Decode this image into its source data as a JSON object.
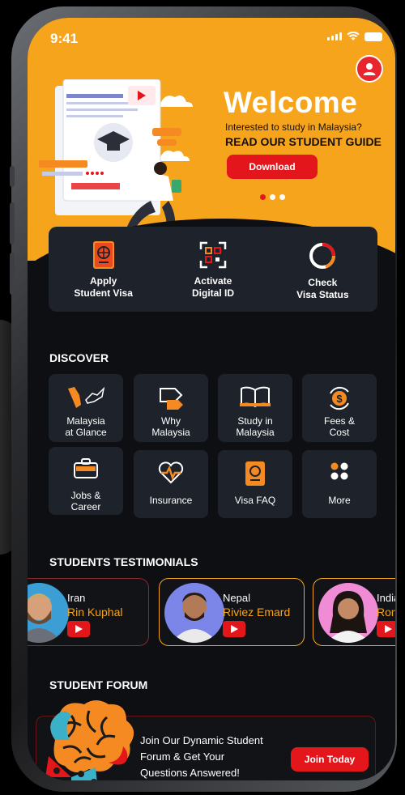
{
  "status": {
    "time": "9:41"
  },
  "hero": {
    "title": "Welcome",
    "subtitle": "Interested to study in Malaysia?",
    "guide": "READ OUR STUDENT GUIDE",
    "download_label": "Download",
    "slides": 3,
    "active_slide": 0
  },
  "quick_actions": [
    {
      "label": "Apply\nStudent Visa",
      "icon": "passport-icon"
    },
    {
      "label": "Activate\nDigital ID",
      "icon": "qr-code-icon"
    },
    {
      "label": "Check\nVisa Status",
      "icon": "status-ring-icon"
    }
  ],
  "discover": {
    "title": "DISCOVER",
    "items": [
      {
        "label": "Malaysia\nat Glance",
        "icon": "map-icon"
      },
      {
        "label": "Why\nMalaysia",
        "icon": "question-tag-icon"
      },
      {
        "label": "Study in\nMalaysia",
        "icon": "book-icon"
      },
      {
        "label": "Fees &\nCost",
        "icon": "dollar-icon"
      },
      {
        "label": "Jobs &\nCareer",
        "icon": "briefcase-icon"
      },
      {
        "label": "Insurance",
        "icon": "heart-pulse-icon"
      },
      {
        "label": "Visa FAQ",
        "icon": "passport-icon"
      },
      {
        "label": "More",
        "icon": "grid-dots-icon"
      }
    ]
  },
  "testimonials": {
    "title": "STUDENTS TESTIMONIALS",
    "items": [
      {
        "country": "Iran",
        "name": "Rin Kuphal"
      },
      {
        "country": "Nepal",
        "name": "Riviez Emard"
      },
      {
        "country": "India",
        "name": "Ron P"
      }
    ]
  },
  "forum": {
    "title": "STUDENT FORUM",
    "text": "Join Our Dynamic Student\nForum & Get Your\nQuestions Answered!",
    "join_label": "Join Today"
  },
  "colors": {
    "accent": "#f7a41d",
    "red": "#e3161c",
    "card": "#1e232b",
    "bg": "#0d0f12"
  }
}
